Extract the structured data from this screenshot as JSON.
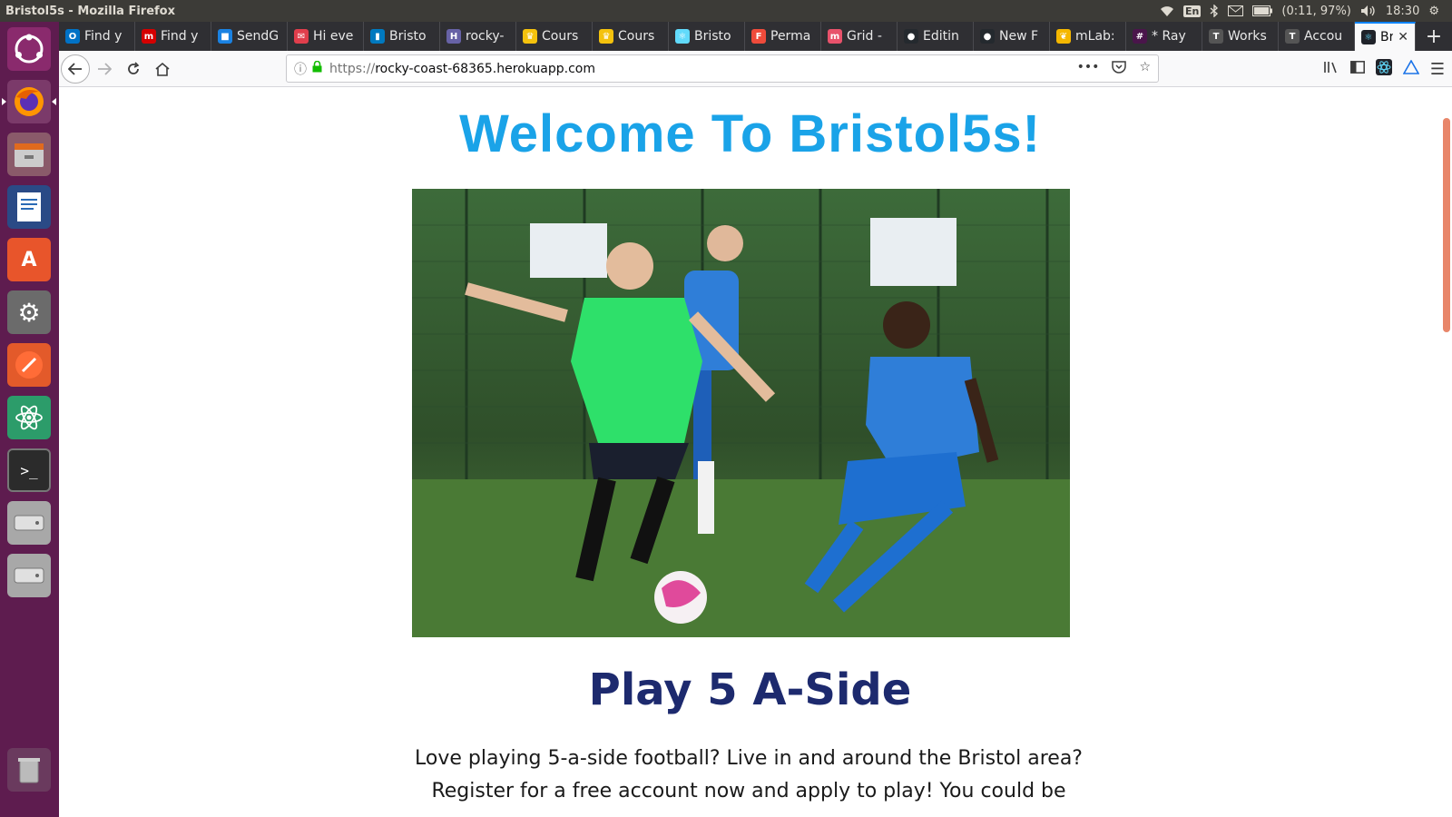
{
  "window_title": "Bristol5s - Mozilla Firefox",
  "system": {
    "lang": "En",
    "battery": "(0:11, 97%)",
    "time": "18:30"
  },
  "tabs": [
    {
      "label": "Find y",
      "icon": "mail-icon",
      "color": "#0072c6"
    },
    {
      "label": "Find y",
      "icon": "m-icon",
      "color": "#d50000"
    },
    {
      "label": "SendG",
      "icon": "sendgrid-icon",
      "color": "#1a82e2"
    },
    {
      "label": "Hi eve",
      "icon": "message-icon",
      "color": "#e03e4c"
    },
    {
      "label": "Bristo",
      "icon": "trello-icon",
      "color": "#0079bf"
    },
    {
      "label": "rocky-",
      "icon": "heroku-icon",
      "color": "#6762a6"
    },
    {
      "label": "Cours",
      "icon": "crown-icon",
      "color": "#f4c20d"
    },
    {
      "label": "Cours",
      "icon": "crown-icon",
      "color": "#f4c20d"
    },
    {
      "label": "Bristo",
      "icon": "react-icon",
      "color": "#61dafb"
    },
    {
      "label": "Perma",
      "icon": "f-icon",
      "color": "#ef4b3b"
    },
    {
      "label": "Grid -",
      "icon": "m-icon",
      "color": "#e8526b"
    },
    {
      "label": "Editin",
      "icon": "github-icon",
      "color": "#24292e"
    },
    {
      "label": "New F",
      "icon": "github-icon",
      "color": "#24292e"
    },
    {
      "label": "mLab:",
      "icon": "leaf-icon",
      "color": "#f5b700"
    },
    {
      "label": "* Ray",
      "icon": "slack-icon",
      "color": "#4a154b"
    },
    {
      "label": "Works",
      "icon": "t-icon",
      "color": "#555555"
    },
    {
      "label": "Accou",
      "icon": "t-icon",
      "color": "#555555"
    }
  ],
  "active_tab": {
    "label": "Bris",
    "icon": "react-icon",
    "color": "#61dafb"
  },
  "url": {
    "protocol": "https://",
    "host": "rocky-coast-68365.herokuapp.com"
  },
  "page": {
    "welcome": "Welcome To Bristol5s!",
    "hero_alt": "Five a side football players",
    "heading": "Play 5 A-Side",
    "intro_line1": "Love playing 5-a-side football? Live in and around the Bristol area?",
    "intro_line2": "Register for a free account now and apply to play! You could be"
  },
  "colors": {
    "welcome": "#1aa3e8",
    "heading": "#1d2a6e",
    "launcher": "#5e1c4f",
    "tab_accent": "#0a84ff"
  }
}
